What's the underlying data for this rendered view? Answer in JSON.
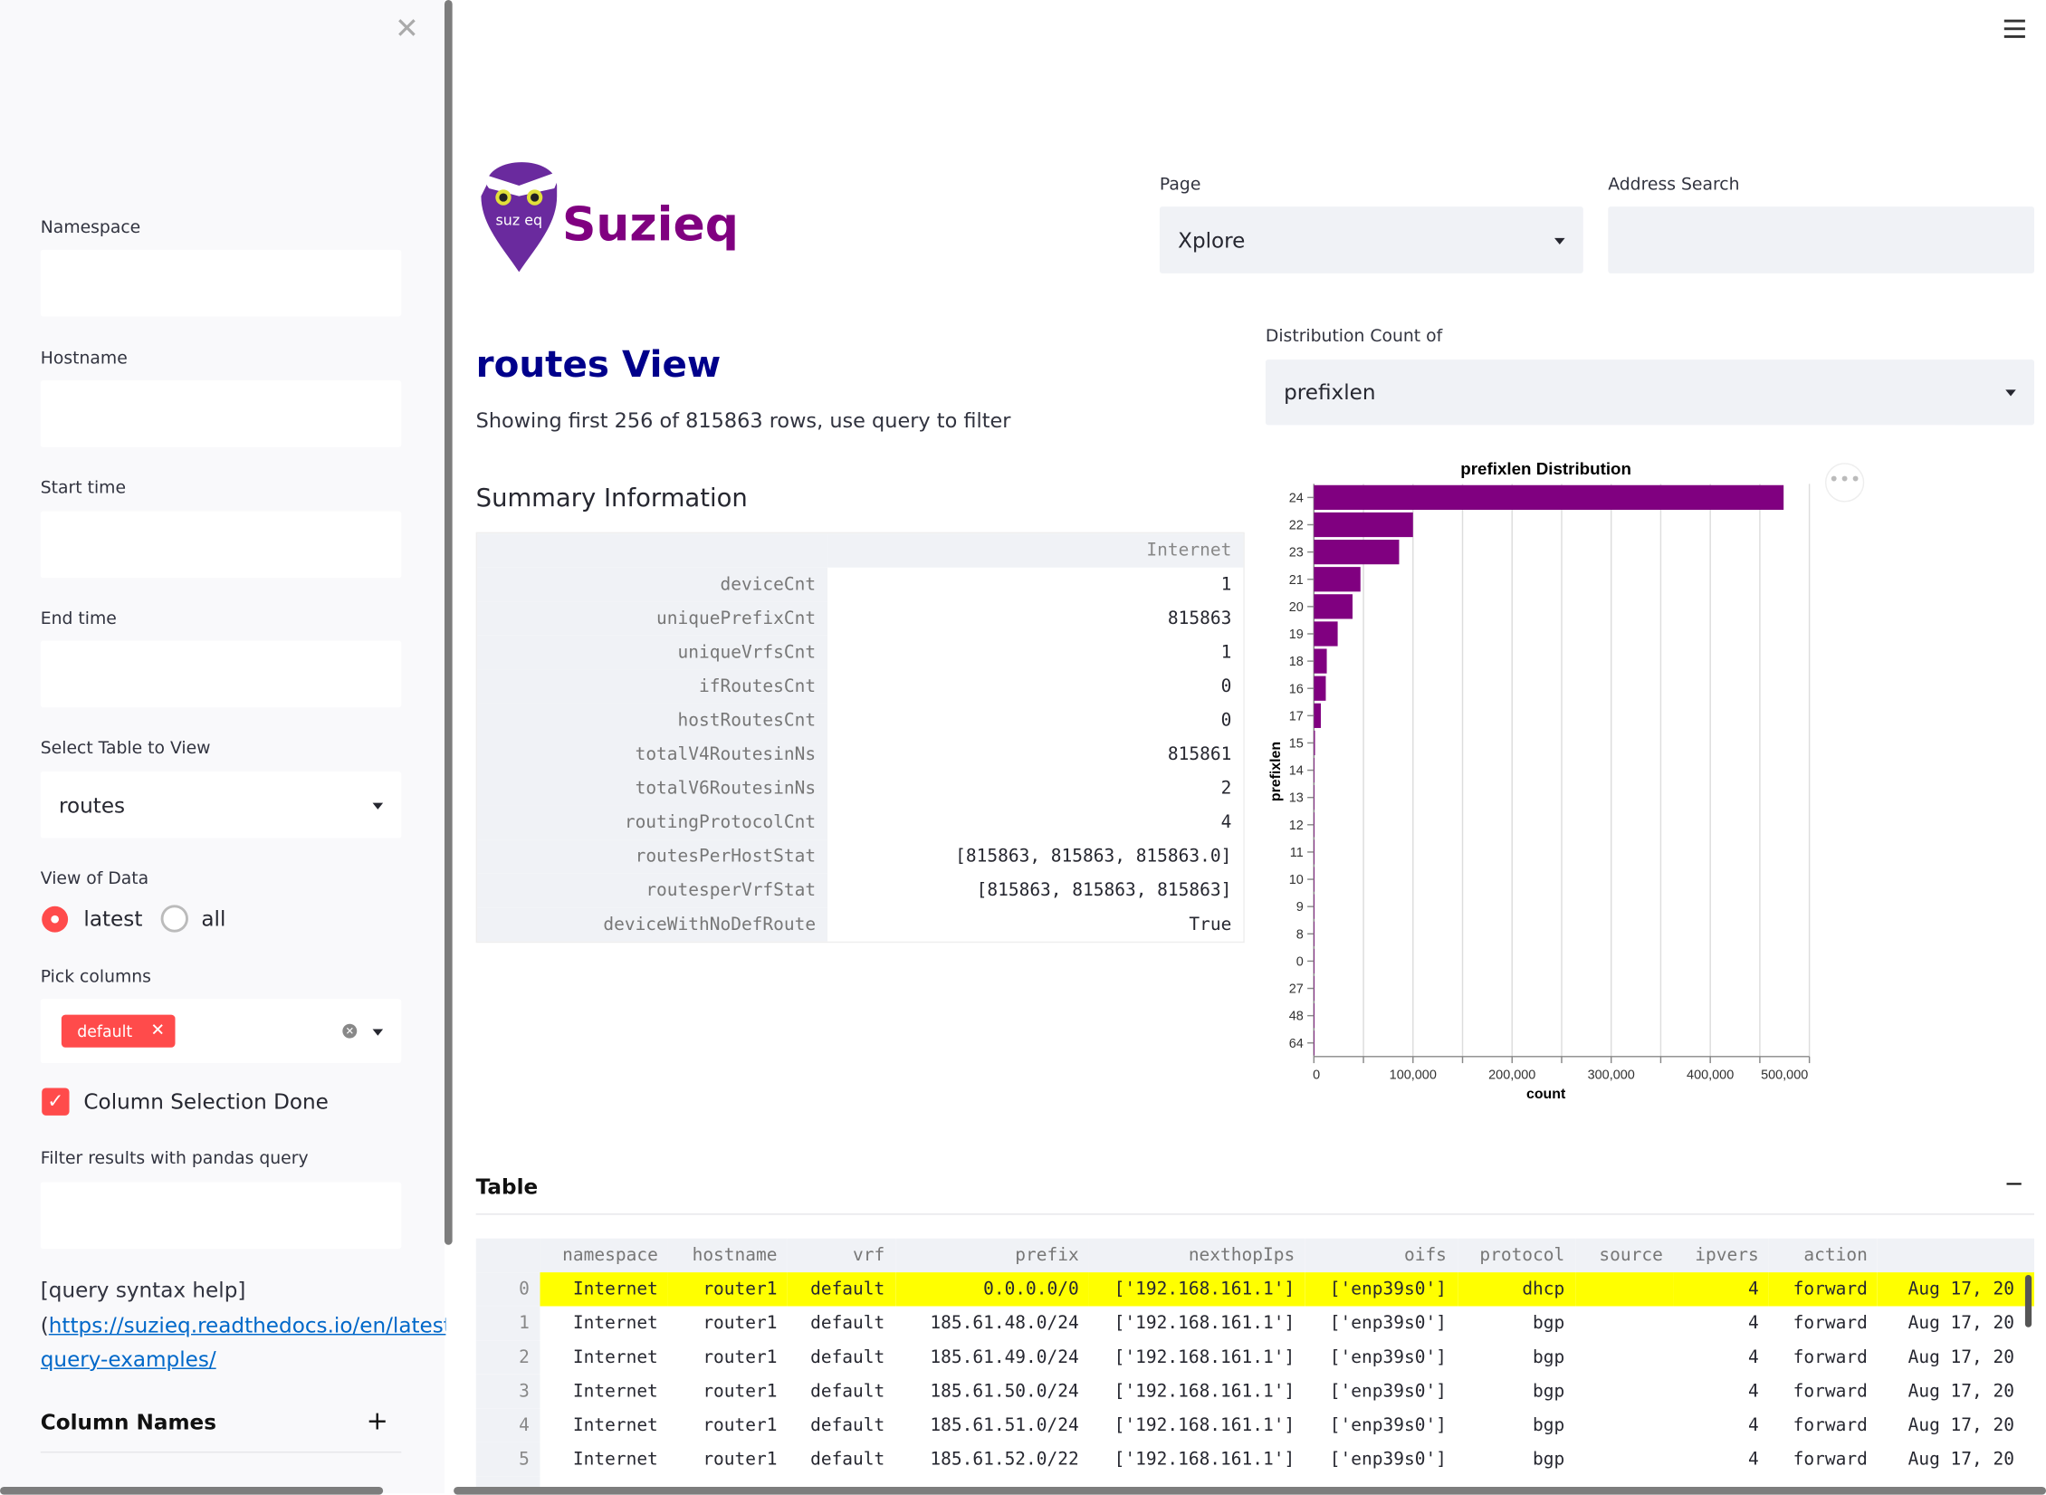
{
  "sidebar": {
    "close_icon": "close-x-icon",
    "namespace_label": "Namespace",
    "namespace_value": "",
    "hostname_label": "Hostname",
    "hostname_value": "",
    "start_time_label": "Start time",
    "start_time_value": "",
    "end_time_label": "End time",
    "end_time_value": "",
    "table_label": "Select Table to View",
    "table_value": "routes",
    "view_label": "View of Data",
    "view_options": [
      {
        "label": "latest",
        "selected": true
      },
      {
        "label": "all",
        "selected": false
      }
    ],
    "columns_label": "Pick columns",
    "columns_tags": [
      "default"
    ],
    "column_done_label": "Column Selection Done",
    "column_done_checked": true,
    "filter_label": "Filter results with pandas query",
    "filter_value": "",
    "help_text": "[query syntax help]",
    "help_paren": "(",
    "help_link_line1": "https://suzieq.readthedocs.io/en/latest/p",
    "help_link_line2": "query-examples/",
    "column_names_label": "Column Names",
    "column_names_expand": "+"
  },
  "header": {
    "menu_icon": "hamburger-icon",
    "logo_text": "Suzieq",
    "logo_badge_text": "SUZIEQ",
    "page_label": "Page",
    "page_value": "Xplore",
    "address_label": "Address Search",
    "address_value": ""
  },
  "main": {
    "title": "routes View",
    "subtitle": "Showing first 256 of 815863 rows, use query to filter",
    "summary_title": "Summary Information",
    "summary_column": "Internet",
    "summary_rows": [
      [
        "deviceCnt",
        "1"
      ],
      [
        "uniquePrefixCnt",
        "815863"
      ],
      [
        "uniqueVrfsCnt",
        "1"
      ],
      [
        "ifRoutesCnt",
        "0"
      ],
      [
        "hostRoutesCnt",
        "0"
      ],
      [
        "totalV4RoutesinNs",
        "815861"
      ],
      [
        "totalV6RoutesinNs",
        "2"
      ],
      [
        "routingProtocolCnt",
        "4"
      ],
      [
        "routesPerHostStat",
        "[815863, 815863, 815863.0]"
      ],
      [
        "routesperVrfStat",
        "[815863, 815863, 815863]"
      ],
      [
        "deviceWithNoDefRoute",
        "True"
      ]
    ],
    "dist_label": "Distribution Count of",
    "dist_value": "prefixlen",
    "table_title": "Table",
    "table_collapse": "−",
    "table_columns": [
      "",
      "namespace",
      "hostname",
      "vrf",
      "prefix",
      "nexthopIps",
      "oifs",
      "protocol",
      "source",
      "ipvers",
      "action",
      ""
    ],
    "table_rows": [
      [
        "0",
        "Internet",
        "router1",
        "default",
        "0.0.0.0/0",
        "['192.168.161.1']",
        "['enp39s0']",
        "dhcp",
        "",
        "4",
        "forward",
        "Aug 17, 20"
      ],
      [
        "1",
        "Internet",
        "router1",
        "default",
        "185.61.48.0/24",
        "['192.168.161.1']",
        "['enp39s0']",
        "bgp",
        "",
        "4",
        "forward",
        "Aug 17, 20"
      ],
      [
        "2",
        "Internet",
        "router1",
        "default",
        "185.61.49.0/24",
        "['192.168.161.1']",
        "['enp39s0']",
        "bgp",
        "",
        "4",
        "forward",
        "Aug 17, 20"
      ],
      [
        "3",
        "Internet",
        "router1",
        "default",
        "185.61.50.0/24",
        "['192.168.161.1']",
        "['enp39s0']",
        "bgp",
        "",
        "4",
        "forward",
        "Aug 17, 20"
      ],
      [
        "4",
        "Internet",
        "router1",
        "default",
        "185.61.51.0/24",
        "['192.168.161.1']",
        "['enp39s0']",
        "bgp",
        "",
        "4",
        "forward",
        "Aug 17, 20"
      ],
      [
        "5",
        "Internet",
        "router1",
        "default",
        "185.61.52.0/22",
        "['192.168.161.1']",
        "['enp39s0']",
        "bgp",
        "",
        "4",
        "forward",
        "Aug 17, 20"
      ]
    ],
    "highlight_row": 0,
    "highlight_color": "#ffff00"
  },
  "colors": {
    "accent": "#ff4b4b",
    "brand": "#800080",
    "title": "#00008b",
    "link": "#0068c9",
    "bar": "#800080"
  },
  "chart_data": {
    "type": "bar",
    "orientation": "horizontal",
    "title": "prefixlen Distribution",
    "xlabel": "count",
    "ylabel": "prefixlen",
    "categories": [
      "24",
      "22",
      "23",
      "21",
      "20",
      "19",
      "18",
      "16",
      "17",
      "15",
      "14",
      "13",
      "12",
      "11",
      "10",
      "9",
      "8",
      "0",
      "27",
      "48",
      "64"
    ],
    "values": [
      474000,
      100000,
      86000,
      47000,
      39000,
      24000,
      13000,
      12000,
      7000,
      1100,
      500,
      200,
      100,
      50,
      20,
      10,
      5,
      1,
      1,
      1,
      1
    ],
    "xlim": [
      0,
      500000
    ],
    "xticks": [
      "0",
      "100,000",
      "200,000",
      "300,000",
      "400,000",
      "500,000"
    ],
    "grid": true,
    "color": "#800080",
    "menu_icon": "more-dots-icon"
  }
}
